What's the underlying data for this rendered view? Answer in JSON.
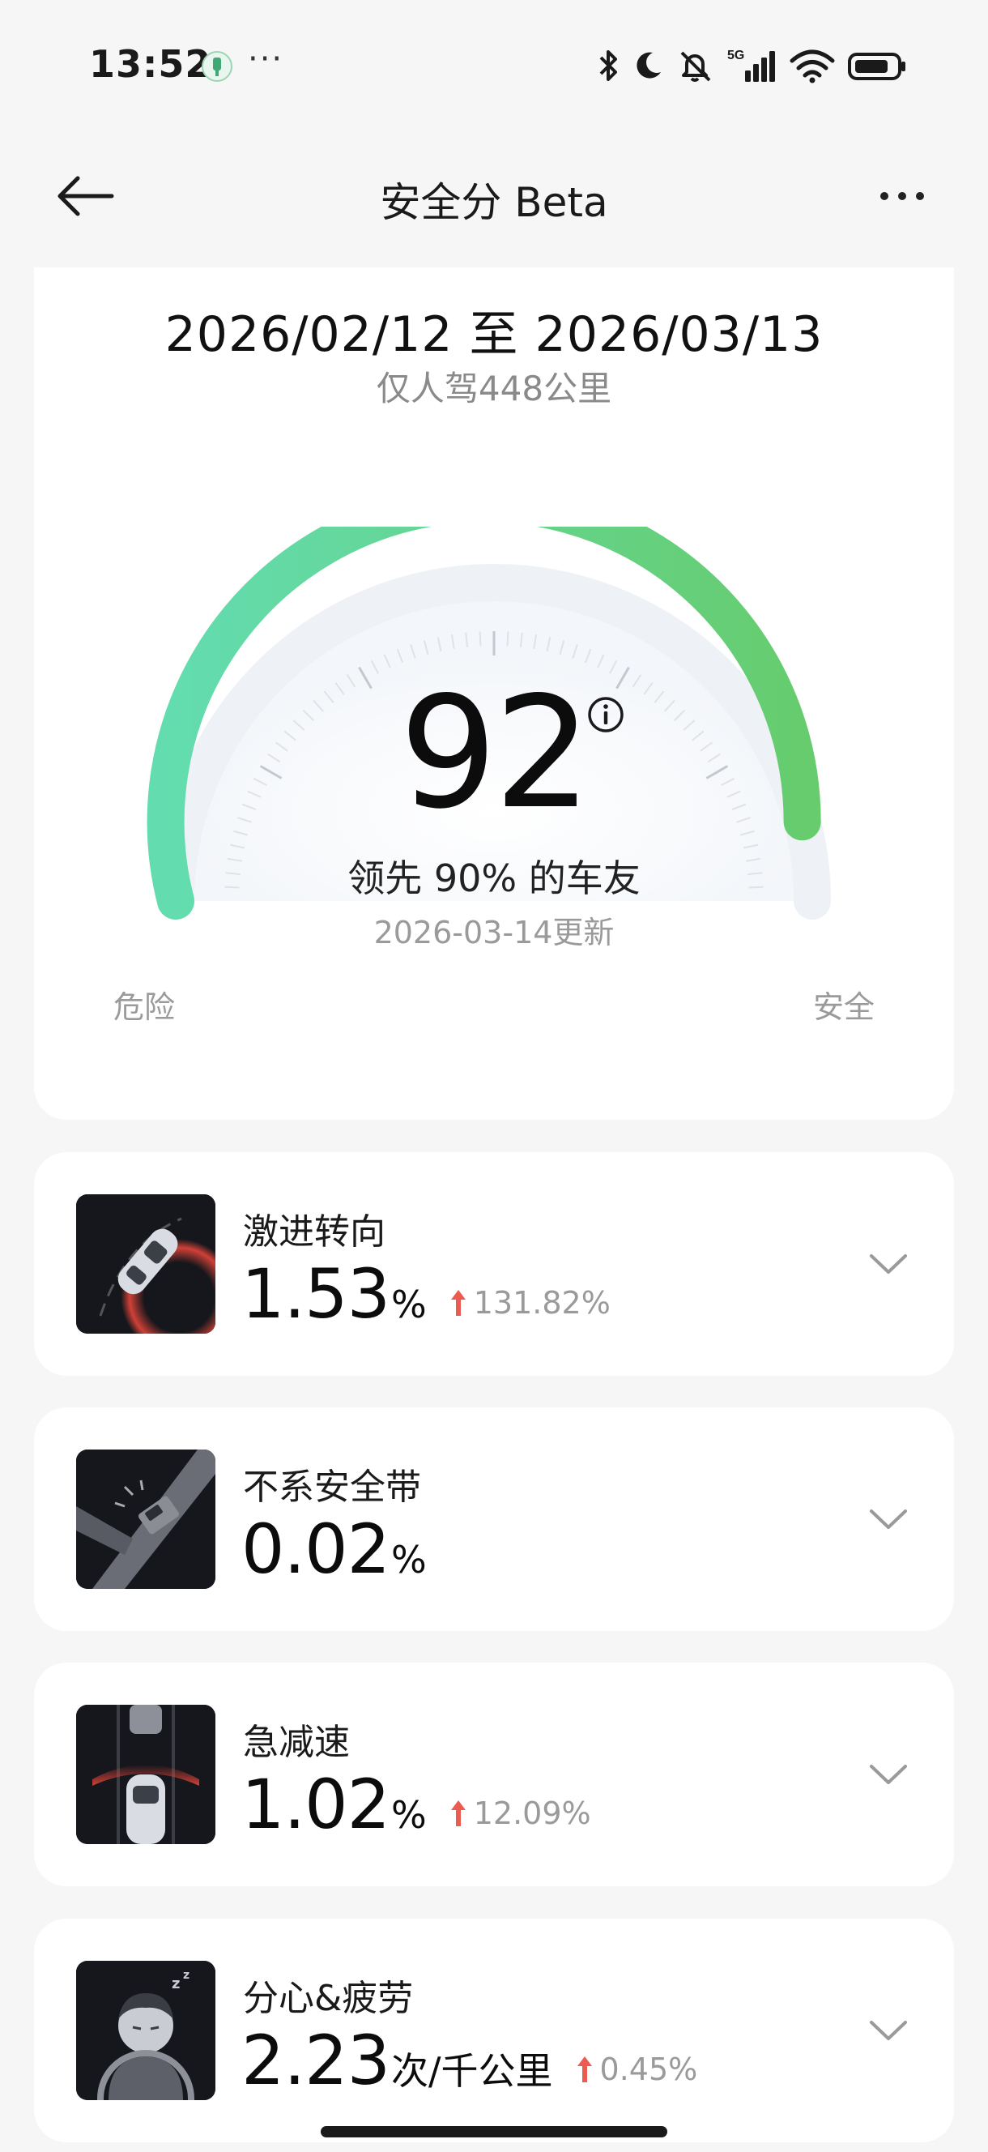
{
  "status_bar": {
    "time": "13:52",
    "dots": "···",
    "network": "5G",
    "icons": [
      "app-notification-icon",
      "bluetooth-icon",
      "moon-icon",
      "bell-muted-icon",
      "signal-icon",
      "wifi-icon",
      "battery-icon"
    ]
  },
  "header": {
    "title": "安全分 Beta",
    "back_icon": "arrow-left-icon",
    "more_icon": "more-horizontal-icon"
  },
  "score_card": {
    "date_range": "2026/02/12 至 2026/03/13",
    "distance_note": "仅人驾448公里",
    "score": "92",
    "score_max": 100,
    "rank_text": "领先 90% 的车友",
    "updated": "2026-03-14更新",
    "label_danger": "危险",
    "label_safe": "安全",
    "gauge_colors": {
      "start": "#63dcb0",
      "end": "#66cc6e",
      "track": "#eef1f6"
    }
  },
  "metrics": [
    {
      "name": "激进转向",
      "value": "1.53",
      "unit": "%",
      "change": "131.82%",
      "trend": "up",
      "icon": "aggressive-turn-icon"
    },
    {
      "name": "不系安全带",
      "value": "0.02",
      "unit": "%",
      "change": "",
      "trend": "",
      "icon": "seatbelt-icon"
    },
    {
      "name": "急减速",
      "value": "1.02",
      "unit": "%",
      "change": "12.09%",
      "trend": "up",
      "icon": "hard-braking-icon"
    },
    {
      "name": "分心&疲劳",
      "value": "2.23",
      "unit": "次/千公里",
      "change": "0.45%",
      "trend": "up",
      "icon": "distraction-fatigue-icon"
    }
  ],
  "colors": {
    "trend_up": "#ec5b4f",
    "background": "#f6f6f6",
    "card": "#ffffff"
  }
}
